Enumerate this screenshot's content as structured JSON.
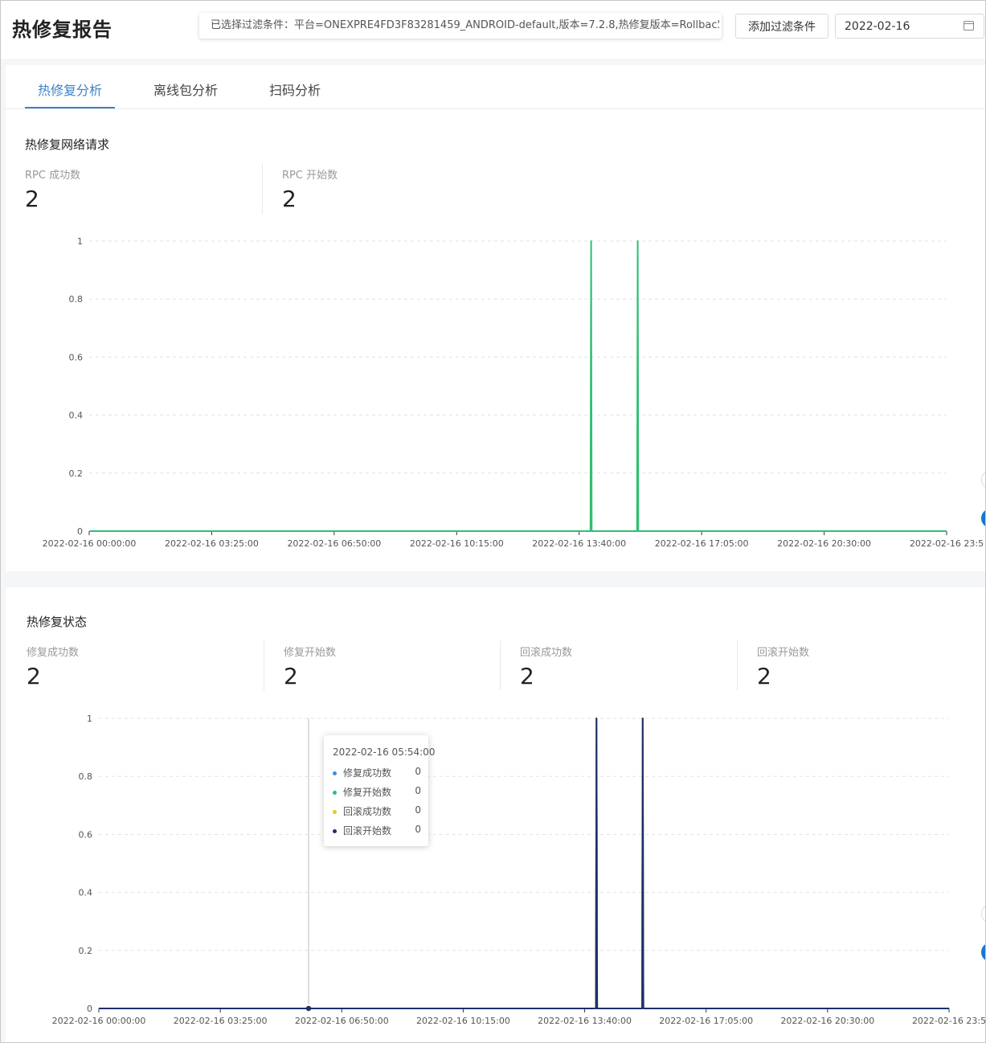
{
  "header": {
    "title": "热修复报告",
    "filter_text": "已选择过滤条件：平台=ONEXPRE4FD3F83281459_ANDROID-default,版本=7.2.8,热修复版本=Rollback",
    "add_filter_label": "添加过滤条件",
    "date_value": "2022-02-16",
    "date_icon": "calendar-icon"
  },
  "tabs": [
    {
      "label": "热修复分析",
      "active": true
    },
    {
      "label": "离线包分析",
      "active": false
    },
    {
      "label": "扫码分析",
      "active": false
    }
  ],
  "section1": {
    "title": "热修复网络请求",
    "stats": [
      {
        "label": "RPC 成功数",
        "value": "2"
      },
      {
        "label": "RPC 开始数",
        "value": "2"
      }
    ]
  },
  "section2": {
    "title": "热修复状态",
    "stats": [
      {
        "label": "修复成功数",
        "value": "2"
      },
      {
        "label": "修复开始数",
        "value": "2"
      },
      {
        "label": "回滚成功数",
        "value": "2"
      },
      {
        "label": "回滚开始数",
        "value": "2"
      }
    ]
  },
  "tooltip": {
    "time": "2022-02-16 05:54:00",
    "rows": [
      {
        "name": "修复成功数",
        "value": "0",
        "color": "#3b8fe0"
      },
      {
        "name": "修复开始数",
        "value": "0",
        "color": "#2fbf71"
      },
      {
        "name": "回滚成功数",
        "value": "0",
        "color": "#f5c518"
      },
      {
        "name": "回滚开始数",
        "value": "0",
        "color": "#1e2f6b"
      }
    ]
  },
  "chart_data": [
    {
      "type": "line",
      "x_ticks": [
        "2022-02-16 00:00:00",
        "2022-02-16 03:25:00",
        "2022-02-16 06:50:00",
        "2022-02-16 10:15:00",
        "2022-02-16 13:40:00",
        "2022-02-16 17:05:00",
        "2022-02-16 20:30:00",
        "2022-02-16 23:5"
      ],
      "y_ticks": [
        "0",
        "0.2",
        "0.4",
        "0.6",
        "0.8",
        "1"
      ],
      "ylim": [
        0,
        1
      ],
      "xlim_minutes": [
        0,
        1435
      ],
      "grid": true,
      "series": [
        {
          "color": "#2fbf71",
          "spike_times": [
            "2022-02-16 14:00:00",
            "2022-02-16 15:18:00"
          ],
          "spike_value": 1
        }
      ]
    },
    {
      "type": "line",
      "x_ticks": [
        "2022-02-16 00:00:00",
        "2022-02-16 03:25:00",
        "2022-02-16 06:50:00",
        "2022-02-16 10:15:00",
        "2022-02-16 13:40:00",
        "2022-02-16 17:05:00",
        "2022-02-16 20:30:00",
        "2022-02-16 23:5"
      ],
      "y_ticks": [
        "0",
        "0.2",
        "0.4",
        "0.6",
        "0.8",
        "1"
      ],
      "ylim": [
        0,
        1
      ],
      "xlim_minutes": [
        0,
        1435
      ],
      "grid": true,
      "hover_time": "2022-02-16 05:54:00",
      "series": [
        {
          "color": "#3b8fe0",
          "spike_times": [
            "2022-02-16 14:00:00",
            "2022-02-16 15:18:00"
          ],
          "spike_value": 1
        },
        {
          "color": "#2fbf71",
          "spike_times": [
            "2022-02-16 14:00:00",
            "2022-02-16 15:18:00"
          ],
          "spike_value": 1
        },
        {
          "color": "#f5c518",
          "spike_times": [
            "2022-02-16 14:00:00",
            "2022-02-16 15:18:00"
          ],
          "spike_value": 1
        },
        {
          "color": "#1e2f6b",
          "spike_times": [
            "2022-02-16 14:00:00",
            "2022-02-16 15:18:00"
          ],
          "spike_value": 1
        }
      ]
    }
  ]
}
